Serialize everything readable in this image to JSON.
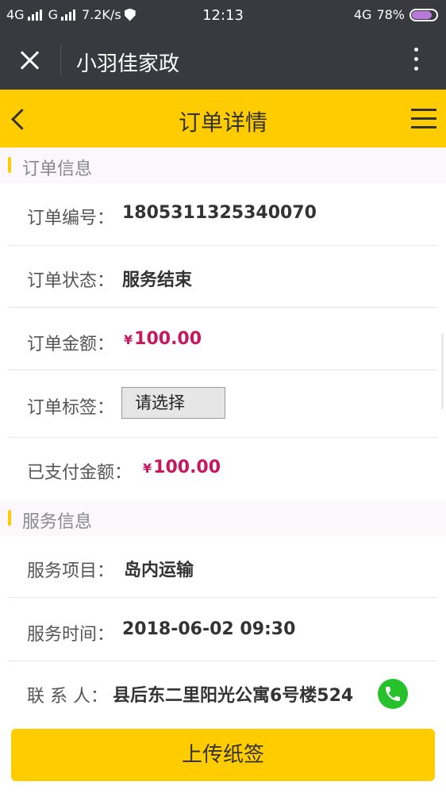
{
  "status_bar": {
    "left_net_1": "4G",
    "left_net_2": "G",
    "speed": "7.2K/s",
    "time": "12:13",
    "right_net": "4G",
    "battery": "78%"
  },
  "wechat_bar": {
    "title": "小羽佳家政"
  },
  "header": {
    "title": "订单详情"
  },
  "order_section": {
    "title": "订单信息",
    "order_no": {
      "label": "订单编号：",
      "value": "1805311325340070"
    },
    "order_status": {
      "label": "订单状态：",
      "value": "服务结束"
    },
    "order_amount": {
      "label": "订单金额：",
      "currency": "¥",
      "value": "100.00"
    },
    "order_tag": {
      "label": "订单标签：",
      "select_value": "请选择"
    },
    "paid_amount": {
      "label": "已支付金额：",
      "currency": "¥",
      "value": "100.00"
    }
  },
  "service_section": {
    "title": "服务信息",
    "service_item": {
      "label": "服务项目：",
      "value": "岛内运输"
    },
    "service_time": {
      "label": "服务时间：",
      "value": "2018-06-02 09:30"
    },
    "contact": {
      "label": "联 系 人：",
      "value": "县后东二里阳光公寓6号楼524"
    }
  },
  "footer": {
    "upload_label": "上传纸签"
  },
  "colors": {
    "accent": "#ffcc00",
    "money": "#c8165f",
    "phone": "#27c22b",
    "titlebar": "#393a3f"
  }
}
